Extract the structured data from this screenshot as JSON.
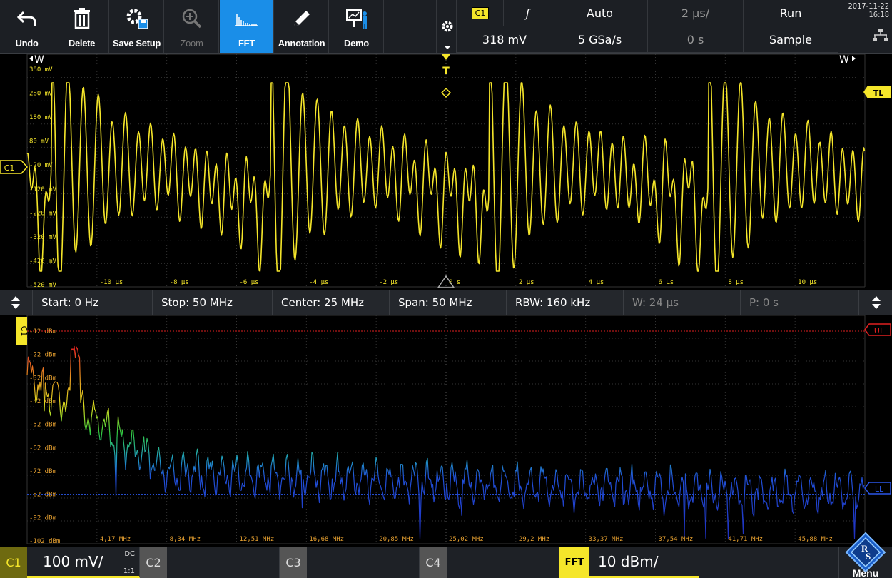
{
  "toolbar": {
    "buttons": [
      {
        "label": "Undo",
        "icon": "undo-arrow-icon"
      },
      {
        "label": "Delete",
        "icon": "trash-icon"
      },
      {
        "label": "Save Setup",
        "icon": "gear-save-icon"
      },
      {
        "label": "Zoom",
        "icon": "zoom-magnifier-icon"
      },
      {
        "label": "FFT",
        "icon": "fft-spectrum-icon"
      },
      {
        "label": "Annotation",
        "icon": "pencil-icon"
      },
      {
        "label": "Demo",
        "icon": "presentation-icon"
      }
    ]
  },
  "header": {
    "channel_badge": "C1",
    "trigger_slope": "ʃ",
    "trigger_mode": "Auto",
    "timebase": "2 µs/",
    "run_state": "Run",
    "trigger_level": "318 mV",
    "sample_rate": "5 GSa/s",
    "trigger_position": "0 s",
    "acquisition_mode": "Sample"
  },
  "datetime": {
    "date": "2017-11-22",
    "time": "16:18"
  },
  "waveform": {
    "y_ticks": [
      "380 mV",
      "280 mV",
      "180 mV",
      "80 mV",
      "-20 mV",
      "-120 mV",
      "-220 mV",
      "-320 mV",
      "-420 mV",
      "-520 mV"
    ],
    "x_ticks": [
      "-10 µs",
      "-8 µs",
      "-6 µs",
      "-4 µs",
      "-2 µs",
      "0 s",
      "2 µs",
      "4 µs",
      "6 µs",
      "8 µs",
      "10 µs"
    ],
    "channel_marker": "C1",
    "trigger_marker": "T",
    "trigger_level_marker": "TL",
    "window_left": "W",
    "window_right": "W",
    "trace_color": "#f5e62a"
  },
  "fft_info": {
    "start": "Start: 0 Hz",
    "stop": "Stop: 50 MHz",
    "center": "Center: 25 MHz",
    "span": "Span: 50 MHz",
    "rbw": "RBW: 160 kHz",
    "window": "W: 24 µs",
    "position": "P: 0 s"
  },
  "spectrum": {
    "y_ticks": [
      "-12 dBm",
      "-22 dBm",
      "-32 dBm",
      "-42 dBm",
      "-52 dBm",
      "-62 dBm",
      "-72 dBm",
      "-82 dBm",
      "-92 dBm",
      "-102 dBm"
    ],
    "x_ticks": [
      "4,17 MHz",
      "8,34 MHz",
      "12,51 MHz",
      "16,68 MHz",
      "20,85 MHz",
      "25,02 MHz",
      "29,2 MHz",
      "33,37 MHz",
      "37,54 MHz",
      "41,71 MHz",
      "45,88 MHz"
    ],
    "channel_marker": "C1",
    "upper_limit_marker": "UL",
    "lower_limit_marker": "LL",
    "upper_limit_dbm": -12,
    "lower_limit_dbm": -82
  },
  "bottom": {
    "c1_label": "C1",
    "c1_scale": "100 mV/",
    "c1_coupling": "DC",
    "c1_ratio": "1:1",
    "c2_label": "C2",
    "c3_label": "C3",
    "c4_label": "C4",
    "fft_label": "FFT",
    "fft_scale": "10 dBm/",
    "menu_label": "Menu"
  },
  "colors": {
    "accent_blue": "#1a8ee8",
    "channel_yellow": "#f5e62a",
    "limit_red": "#e02020",
    "limit_blue": "#2a56e8",
    "tick_orange": "#e6a030"
  }
}
